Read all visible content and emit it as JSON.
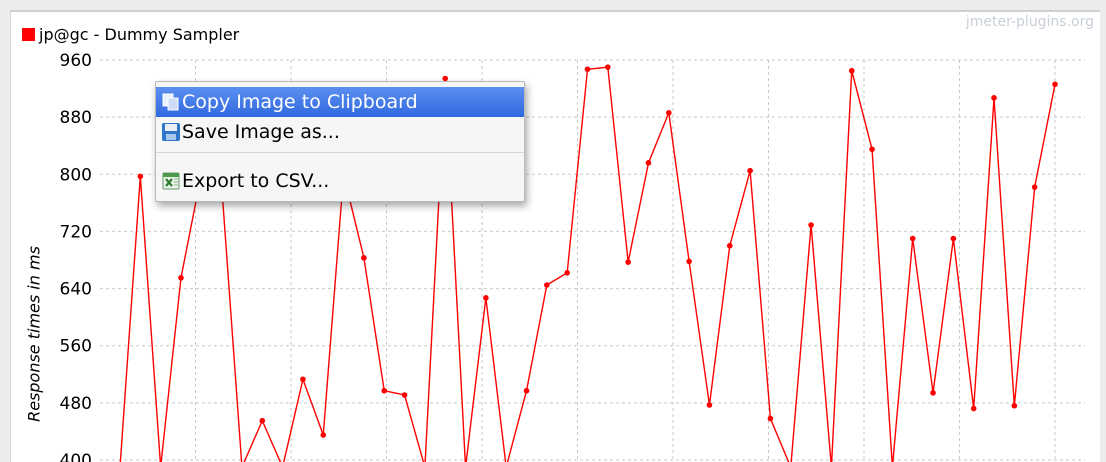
{
  "legend": {
    "label": "jp@gc - Dummy Sampler",
    "color": "#ff0000"
  },
  "watermark": "jmeter-plugins.org",
  "context_menu": {
    "items": [
      {
        "label": "Copy Image to Clipboard",
        "icon": "copy-icon",
        "highlighted": true
      },
      {
        "label": "Save Image as...",
        "icon": "floppy-disk-icon",
        "highlighted": false
      },
      {
        "label": "Export to CSV...",
        "icon": "spreadsheet-icon",
        "highlighted": false
      }
    ],
    "highlight_color": "#3f7be8"
  },
  "chart_data": {
    "type": "line",
    "ylabel": "Response times in ms",
    "ylim": [
      400,
      960
    ],
    "yticks": [
      "960",
      "880",
      "800",
      "720",
      "640",
      "560",
      "480",
      "400"
    ],
    "grid": true,
    "series": [
      {
        "name": "jp@gc - Dummy Sampler",
        "color": "#ff0000",
        "values": [
          390,
          797,
          390,
          655,
          800,
          785,
          390,
          455,
          390,
          513,
          435,
          800,
          683,
          497,
          491,
          390,
          934,
          390,
          627,
          390,
          497,
          645,
          662,
          947,
          950,
          677,
          816,
          886,
          678,
          477,
          700,
          805,
          458,
          390,
          729,
          390,
          945,
          835,
          390,
          710,
          494,
          710,
          472,
          907,
          476,
          782,
          926
        ]
      }
    ]
  }
}
